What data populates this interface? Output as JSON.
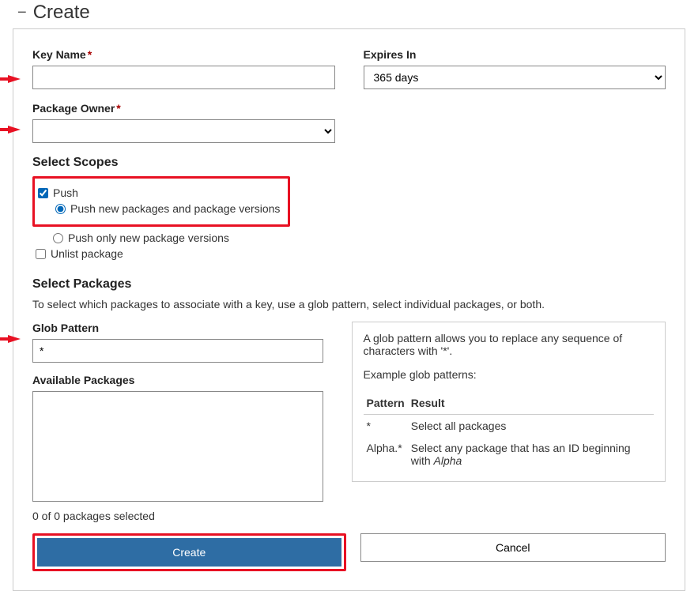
{
  "pageTitle": "Create",
  "fields": {
    "keyName": {
      "label": "Key Name",
      "required": "*",
      "value": ""
    },
    "expiresIn": {
      "label": "Expires In",
      "value": "365 days"
    },
    "packageOwner": {
      "label": "Package Owner",
      "required": "*",
      "value": ""
    }
  },
  "scopes": {
    "heading": "Select Scopes",
    "push": {
      "label": "Push",
      "checked": true
    },
    "pushNew": {
      "label": "Push new packages and package versions",
      "checked": true
    },
    "pushOnly": {
      "label": "Push only new package versions",
      "checked": false
    },
    "unlist": {
      "label": "Unlist package",
      "checked": false
    }
  },
  "packages": {
    "heading": "Select Packages",
    "desc": "To select which packages to associate with a key, use a glob pattern, select individual packages, or both.",
    "globLabel": "Glob Pattern",
    "globValue": "*",
    "availableLabel": "Available Packages",
    "selectedCount": "0 of 0 packages selected"
  },
  "help": {
    "para1": "A glob pattern allows you to replace any sequence of characters with '*'.",
    "para2": "Example glob patterns:",
    "colPattern": "Pattern",
    "colResult": "Result",
    "rows": [
      {
        "pattern": "*",
        "result": "Select all packages"
      },
      {
        "pattern": "Alpha.*",
        "resultPrefix": "Select any package that has an ID beginning with ",
        "resultEm": "Alpha"
      }
    ]
  },
  "buttons": {
    "create": "Create",
    "cancel": "Cancel"
  }
}
